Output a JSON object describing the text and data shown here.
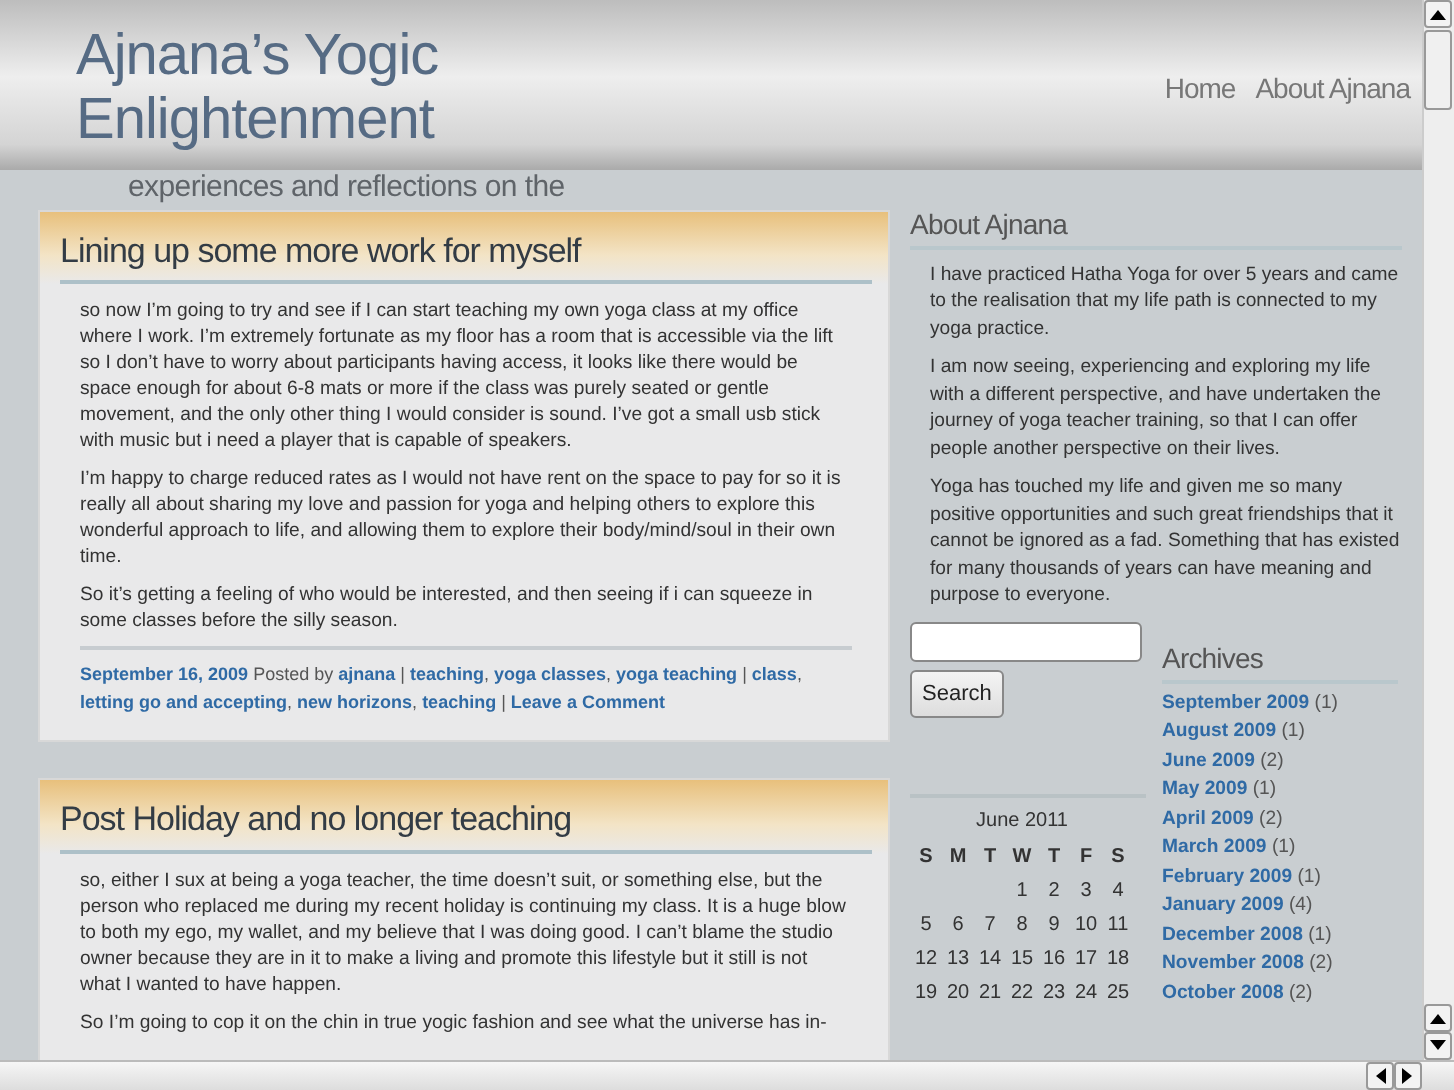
{
  "header": {
    "title": "Ajnana’s Yogic Enlightenment",
    "tagline": "experiences and reflections on the",
    "nav": [
      {
        "label": "Home"
      },
      {
        "label": "About Ajnana"
      }
    ]
  },
  "posts": [
    {
      "title": "Lining up some more work for myself",
      "paragraphs": [
        "so now I’m going to try and see if I can start teaching my own yoga class at my office where I work. I’m extremely fortunate as my floor has a room that is accessible via the lift so I don’t have to worry about participants having access, it looks like there would be space enough for about 6-8 mats or more if the class was purely seated or gentle movement, and the only other thing I would consider is sound. I’ve got a small usb stick with music but i need a player that is capable of speakers.",
        "I’m happy to charge reduced rates as I would not have rent on the space to pay for so it is really all about sharing my love and passion for yoga and helping others to explore this wonderful approach to life, and allowing them to explore their body/mind/soul in their own time.",
        "So it’s getting a feeling of who would be interested, and then seeing if i can squeeze in some classes before the silly season."
      ],
      "meta": [
        {
          "kind": "link",
          "text": "September 16, 2009"
        },
        {
          "kind": "text",
          "text": " Posted by "
        },
        {
          "kind": "link",
          "text": "ajnana"
        },
        {
          "kind": "text",
          "text": " | "
        },
        {
          "kind": "link",
          "text": "teaching"
        },
        {
          "kind": "text",
          "text": ", "
        },
        {
          "kind": "link",
          "text": "yoga classes"
        },
        {
          "kind": "text",
          "text": ", "
        },
        {
          "kind": "link",
          "text": "yoga teaching"
        },
        {
          "kind": "text",
          "text": " | "
        },
        {
          "kind": "link",
          "text": "class"
        },
        {
          "kind": "text",
          "text": ", "
        },
        {
          "kind": "link",
          "text": "letting go and accepting"
        },
        {
          "kind": "text",
          "text": ", "
        },
        {
          "kind": "link",
          "text": "new horizons"
        },
        {
          "kind": "text",
          "text": ", "
        },
        {
          "kind": "link",
          "text": "teaching"
        },
        {
          "kind": "text",
          "text": " | "
        },
        {
          "kind": "link",
          "text": "Leave a Comment"
        }
      ]
    },
    {
      "title": "Post Holiday and no longer teaching",
      "paragraphs": [
        "so, either I sux at being a yoga teacher, the time doesn’t suit, or something else, but the person who replaced me during my recent holiday is continuing my class. It is a huge blow to both my ego, my wallet, and my believe that I was doing good.  I can’t blame the studio owner because they are in it to make a living and promote this lifestyle but it still is not what I wanted to have happen.",
        "So I’m going to cop it on the chin in true yogic fashion and see what the universe has in-"
      ]
    }
  ],
  "sidebar": {
    "about": {
      "title": "About Ajnana",
      "paragraphs": [
        "I have practiced Hatha Yoga for over 5 years and came to the realisation that my life path is connected to my yoga practice.",
        "I am now seeing, experiencing and exploring  my life with a different perspective, and have undertaken the journey of yoga teacher training, so that I can offer people another perspective on their lives.",
        "Yoga has touched my life and given me so many positive opportunities and such great friendships that it cannot be ignored as a fad. Something that has existed for many thousands of years  can have meaning and purpose to everyone."
      ]
    },
    "search": {
      "button": "Search"
    },
    "calendar": {
      "title": "June 2011",
      "weekdays": [
        "S",
        "M",
        "T",
        "W",
        "T",
        "F",
        "S"
      ],
      "weeks": [
        [
          "1",
          "2",
          "3",
          "4"
        ],
        [
          "5",
          "6",
          "7",
          "8",
          "9",
          "10",
          "11"
        ],
        [
          "12",
          "13",
          "14",
          "15",
          "16",
          "17",
          "18"
        ],
        [
          "19",
          "20",
          "21",
          "22",
          "23",
          "24",
          "25"
        ]
      ]
    },
    "archives": {
      "title": "Archives",
      "items": [
        {
          "label": "September 2009",
          "count": "(1)"
        },
        {
          "label": "August 2009",
          "count": "(1)"
        },
        {
          "label": "June 2009",
          "count": "(2)"
        },
        {
          "label": "May 2009",
          "count": "(1)"
        },
        {
          "label": "April 2009",
          "count": "(2)"
        },
        {
          "label": "March 2009",
          "count": "(1)"
        },
        {
          "label": "February 2009",
          "count": "(1)"
        },
        {
          "label": "January 2009",
          "count": "(4)"
        },
        {
          "label": "December 2008",
          "count": "(1)"
        },
        {
          "label": "November 2008",
          "count": "(2)"
        },
        {
          "label": "October 2008",
          "count": "(2)"
        }
      ]
    }
  }
}
